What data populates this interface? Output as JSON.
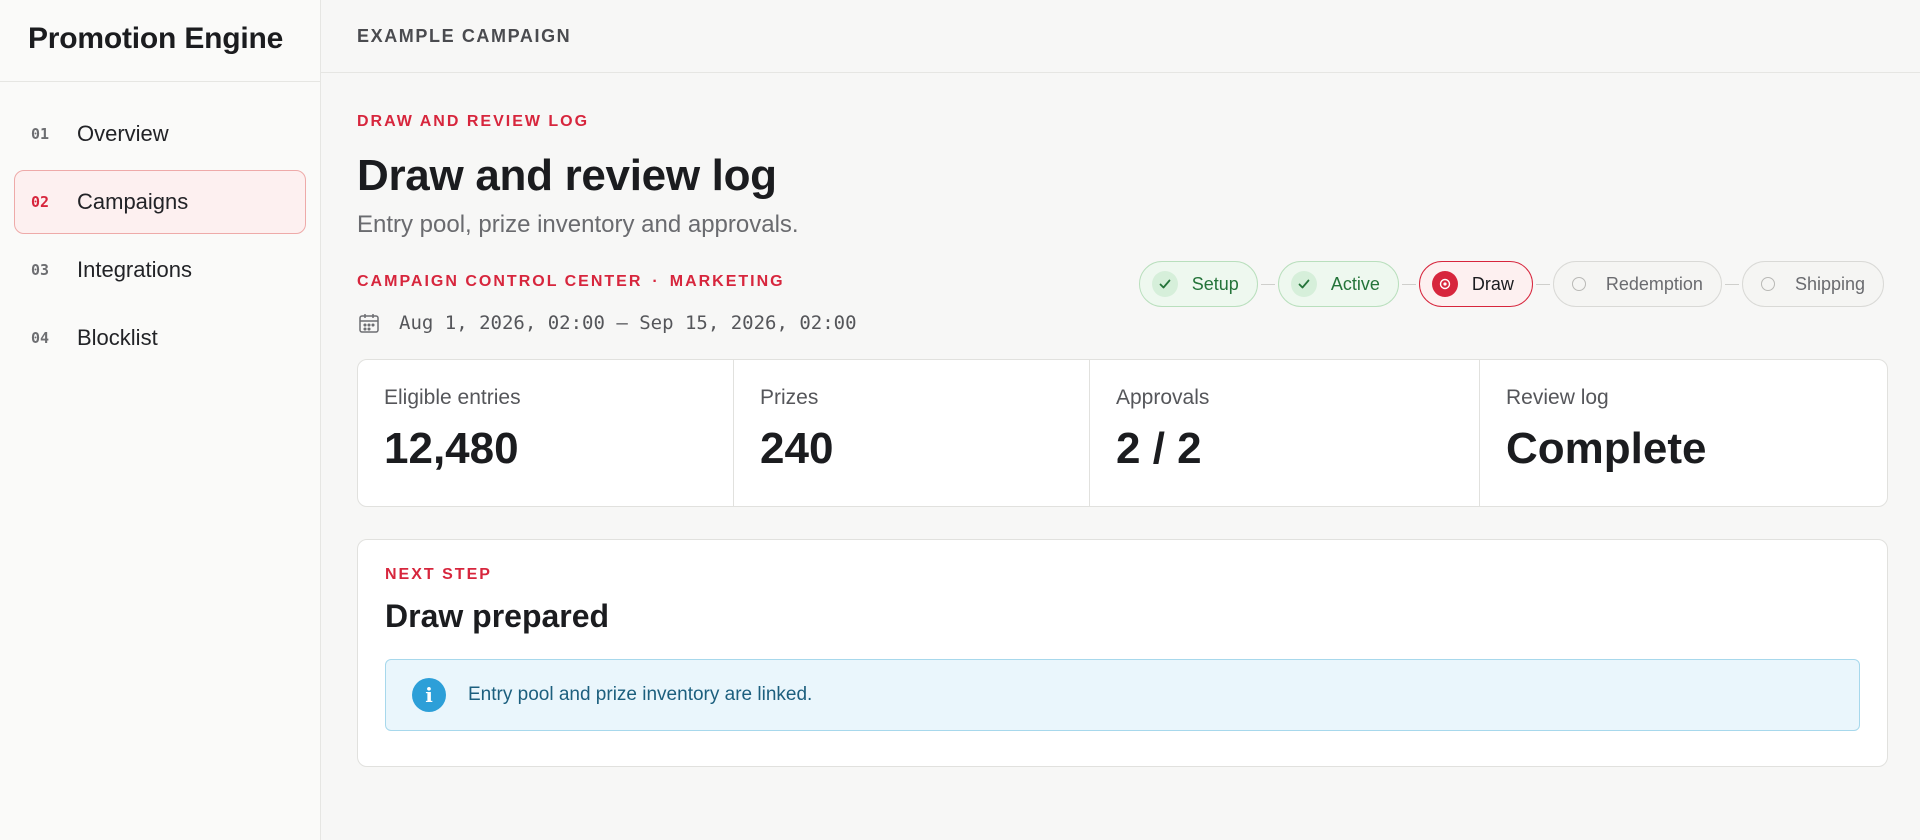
{
  "app": {
    "title": "Promotion Engine"
  },
  "sidebar": {
    "items": [
      {
        "num": "01",
        "label": "Overview"
      },
      {
        "num": "02",
        "label": "Campaigns"
      },
      {
        "num": "03",
        "label": "Integrations"
      },
      {
        "num": "04",
        "label": "Blocklist"
      }
    ]
  },
  "header": {
    "breadcrumb": "EXAMPLE CAMPAIGN"
  },
  "page": {
    "eyebrow": "DRAW AND REVIEW LOG",
    "title": "Draw and review log",
    "subtitle": "Entry pool, prize inventory and approvals.",
    "context_left": "CAMPAIGN CONTROL CENTER",
    "context_dot": "·",
    "context_right": "MARKETING",
    "date_range": "Aug 1, 2026, 02:00 — Sep 15, 2026, 02:00"
  },
  "stepper": {
    "steps": [
      {
        "label": "Setup",
        "state": "done"
      },
      {
        "label": "Active",
        "state": "done"
      },
      {
        "label": "Draw",
        "state": "current"
      },
      {
        "label": "Redemption",
        "state": "pending"
      },
      {
        "label": "Shipping",
        "state": "pending"
      }
    ]
  },
  "stats": [
    {
      "label": "Eligible entries",
      "value": "12,480"
    },
    {
      "label": "Prizes",
      "value": "240"
    },
    {
      "label": "Approvals",
      "value": "2 / 2"
    },
    {
      "label": "Review log",
      "value": "Complete"
    }
  ],
  "next_step": {
    "eyebrow": "NEXT STEP",
    "title": "Draw prepared",
    "info_glyph": "i",
    "message": "Entry pool and prize inventory are linked."
  },
  "colors": {
    "accent": "#d7263d",
    "success": "#25743a",
    "info": "#2d9fd8"
  }
}
